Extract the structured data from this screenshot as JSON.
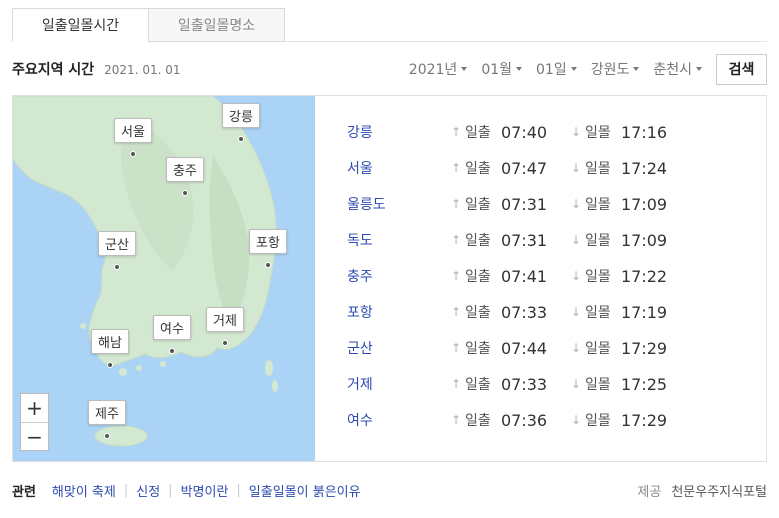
{
  "tabs": [
    {
      "label": "일출일몰시간",
      "active": true
    },
    {
      "label": "일출일몰명소",
      "active": false
    }
  ],
  "header": {
    "title": "주요지역 시간",
    "date": "2021. 01. 01",
    "filters": {
      "year": "2021년",
      "month": "01월",
      "day": "01일",
      "province": "강원도",
      "city": "춘천시"
    },
    "search_label": "검색"
  },
  "map": {
    "pins": [
      {
        "label": "강릉"
      },
      {
        "label": "서울"
      },
      {
        "label": "충주"
      },
      {
        "label": "군산"
      },
      {
        "label": "포항"
      },
      {
        "label": "여수"
      },
      {
        "label": "거제"
      },
      {
        "label": "해남"
      },
      {
        "label": "제주"
      }
    ],
    "zoom_in": "+",
    "zoom_out": "−",
    "colors": {
      "sea": "#aad3f5",
      "land": "#d3e8d1"
    }
  },
  "times": {
    "sunrise_label": "일출",
    "sunset_label": "일몰",
    "rows": [
      {
        "city": "강릉",
        "sunrise": "07:40",
        "sunset": "17:16"
      },
      {
        "city": "서울",
        "sunrise": "07:47",
        "sunset": "17:24"
      },
      {
        "city": "울릉도",
        "sunrise": "07:31",
        "sunset": "17:09"
      },
      {
        "city": "독도",
        "sunrise": "07:31",
        "sunset": "17:09"
      },
      {
        "city": "충주",
        "sunrise": "07:41",
        "sunset": "17:22"
      },
      {
        "city": "포항",
        "sunrise": "07:33",
        "sunset": "17:19"
      },
      {
        "city": "군산",
        "sunrise": "07:44",
        "sunset": "17:29"
      },
      {
        "city": "거제",
        "sunrise": "07:33",
        "sunset": "17:25"
      },
      {
        "city": "여수",
        "sunrise": "07:36",
        "sunset": "17:29"
      }
    ]
  },
  "footer": {
    "related_title": "관련",
    "links": [
      "해맞이 축제",
      "신정",
      "박명이란",
      "일출일몰이 붉은이유"
    ],
    "provider_label": "제공",
    "provider_name": "천문우주지식포털"
  }
}
